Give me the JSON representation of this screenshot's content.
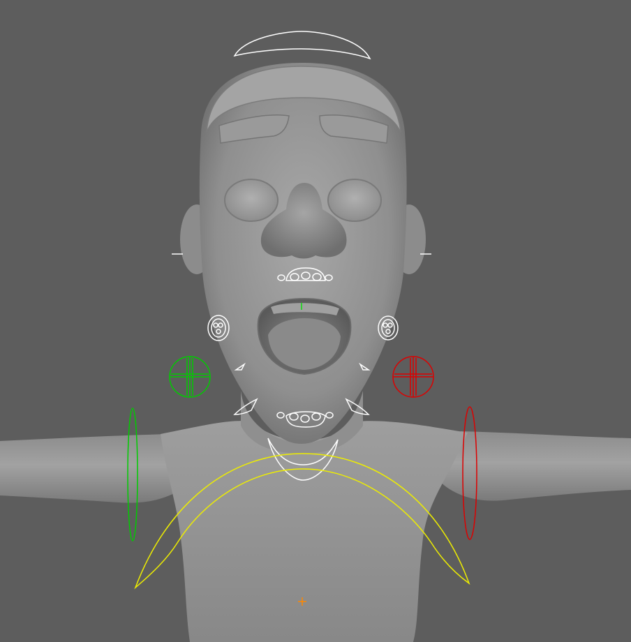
{
  "viewport": {
    "background": "#5d5d5d",
    "model_color": "#9a9a9a"
  },
  "controls": [
    {
      "name": "head-top-control",
      "color": "#ffffff",
      "shape": "arc"
    },
    {
      "name": "ear-left-control",
      "color": "#ffffff",
      "shape": "line"
    },
    {
      "name": "ear-right-control",
      "color": "#ffffff",
      "shape": "line"
    },
    {
      "name": "upper-lip-control",
      "color": "#ffffff",
      "shape": "lip-cluster"
    },
    {
      "name": "jaw-pivot-control",
      "color": "#33cc33",
      "shape": "tick"
    },
    {
      "name": "cheek-left-control",
      "color": "#ffffff",
      "shape": "concentric-circles"
    },
    {
      "name": "cheek-right-control",
      "color": "#ffffff",
      "shape": "concentric-circles"
    },
    {
      "name": "eye-left-control",
      "color": "#00cc00",
      "shape": "crosshair-circle"
    },
    {
      "name": "eye-right-control",
      "color": "#dd0000",
      "shape": "crosshair-circle"
    },
    {
      "name": "lower-lip-control",
      "color": "#ffffff",
      "shape": "lip-cluster"
    },
    {
      "name": "jaw-control",
      "color": "#ffffff",
      "shape": "crescent"
    },
    {
      "name": "shoulder-left-control",
      "color": "#00cc00",
      "shape": "ellipse"
    },
    {
      "name": "shoulder-right-control",
      "color": "#dd0000",
      "shape": "ellipse"
    },
    {
      "name": "chest-control",
      "color": "#eeee00",
      "shape": "arc"
    },
    {
      "name": "pivot-marker",
      "color": "#ff8800",
      "shape": "cross"
    }
  ]
}
